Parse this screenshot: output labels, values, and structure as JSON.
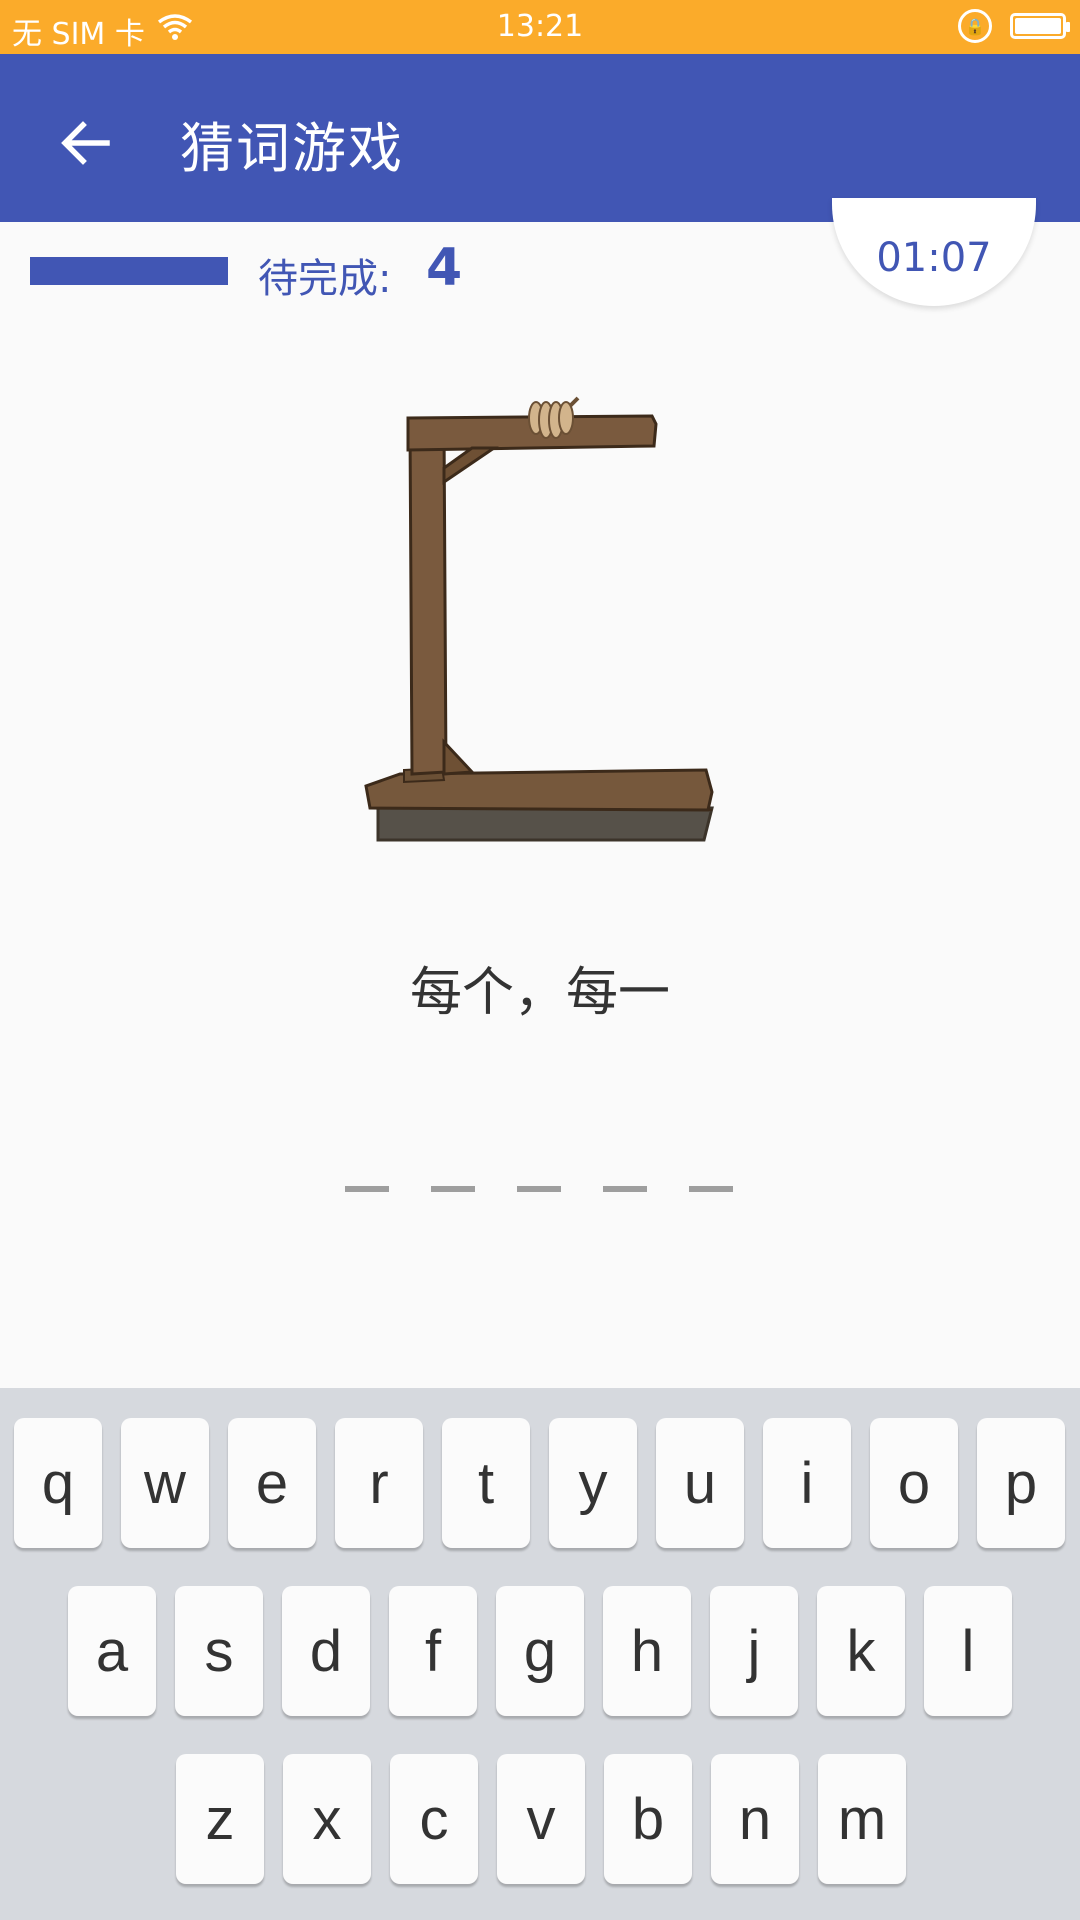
{
  "status_bar": {
    "carrier": "无 SIM 卡",
    "time": "13:21"
  },
  "app_bar": {
    "title": "猜词游戏"
  },
  "game": {
    "progress_fraction": 1.0,
    "remaining_label": "待完成:",
    "remaining_count": "4",
    "timer": "01:07",
    "hint": "每个，每一",
    "blank_count": 5
  },
  "keyboard": {
    "rows": [
      [
        "q",
        "w",
        "e",
        "r",
        "t",
        "y",
        "u",
        "i",
        "o",
        "p"
      ],
      [
        "a",
        "s",
        "d",
        "f",
        "g",
        "h",
        "j",
        "k",
        "l"
      ],
      [
        "z",
        "x",
        "c",
        "v",
        "b",
        "n",
        "m"
      ]
    ]
  },
  "colors": {
    "status_bar": "#fbab2a",
    "primary": "#4156b4",
    "keyboard_bg": "#d6d9de"
  }
}
